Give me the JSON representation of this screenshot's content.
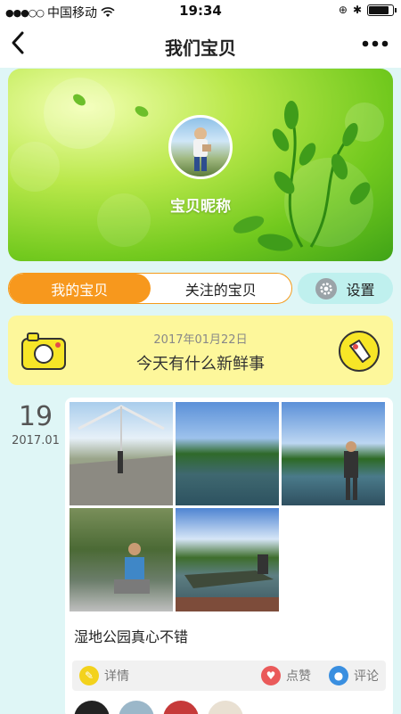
{
  "status_bar": {
    "signal_dots": "●●●○○",
    "carrier": "中国移动",
    "time": "19:34"
  },
  "nav": {
    "title": "我们宝贝",
    "back_icon": "back-chevron-icon",
    "more_icon": "more-dots-icon"
  },
  "hero": {
    "nickname": "宝贝昵称"
  },
  "tabs": {
    "my_baby": "我的宝贝",
    "followed": "关注的宝贝",
    "settings": "设置"
  },
  "news": {
    "date": "2017年01月22日",
    "prompt": "今天有什么新鲜事"
  },
  "post": {
    "day": "19",
    "year_month": "2017.01",
    "text": "湿地公园真心不错",
    "photo_count": 5,
    "actions": {
      "detail": "详情",
      "like": "点赞",
      "comment": "评论"
    }
  },
  "colors": {
    "accent_orange": "#f7981d",
    "background": "#dff6f6",
    "news_yellow": "#fdf79b",
    "settings_teal": "#bff0ee"
  }
}
